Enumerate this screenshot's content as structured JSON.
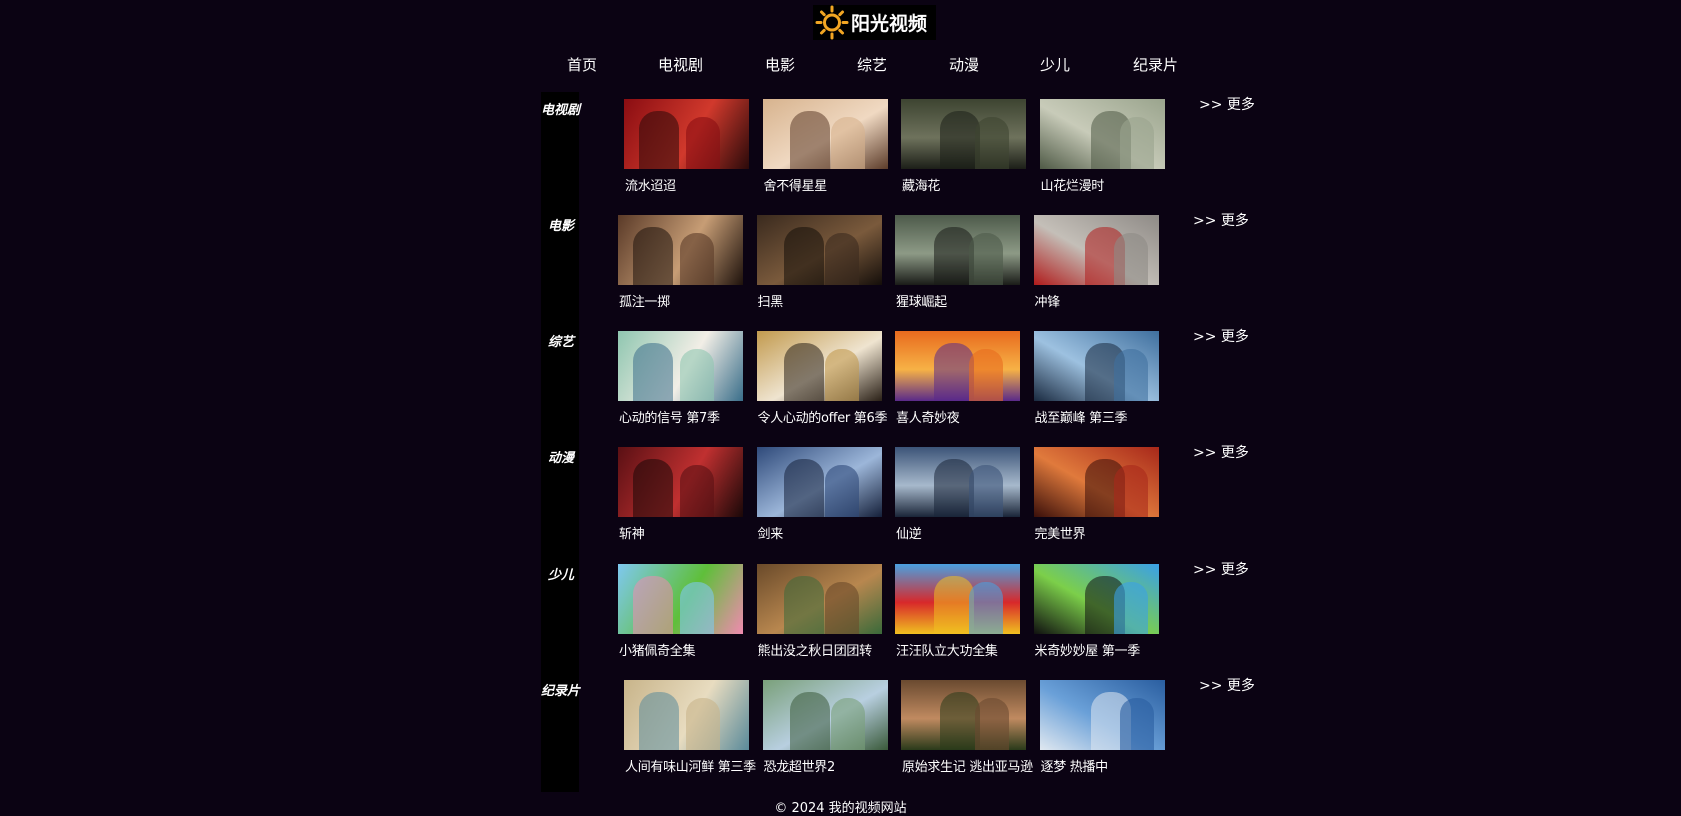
{
  "logo": {
    "text": "阳光视频"
  },
  "nav": [
    "首页",
    "电视剧",
    "电影",
    "综艺",
    "动漫",
    "少儿",
    "纪录片"
  ],
  "more_label": ">> 更多",
  "sections": [
    {
      "title": "电视剧",
      "items": [
        {
          "title": "流水迢迢",
          "palette": [
            "#8a0d12",
            "#d1392c",
            "#2a0a0a"
          ]
        },
        {
          "title": "舍不得星星",
          "palette": [
            "#d7b38e",
            "#f0d9c2",
            "#5c3c2a"
          ]
        },
        {
          "title": "藏海花",
          "palette": [
            "#3d4431",
            "#6e725c",
            "#1c1f18"
          ]
        },
        {
          "title": "山花烂漫时",
          "palette": [
            "#9aa48d",
            "#c8cbb9",
            "#4f5a46"
          ]
        }
      ]
    },
    {
      "title": "电影",
      "items": [
        {
          "title": "孤注一掷",
          "palette": [
            "#5a3a28",
            "#c79d75",
            "#1e120c"
          ]
        },
        {
          "title": "扫黑",
          "palette": [
            "#3a2a1e",
            "#7a5a3c",
            "#140e0a"
          ]
        },
        {
          "title": "猩球崛起",
          "palette": [
            "#4d5a4a",
            "#8d9a86",
            "#1a1c18"
          ]
        },
        {
          "title": "冲锋",
          "palette": [
            "#8e8a86",
            "#c4bfb8",
            "#b01b1b"
          ]
        }
      ]
    },
    {
      "title": "综艺",
      "items": [
        {
          "title": "心动的信号 第7季",
          "palette": [
            "#8fc6b0",
            "#f2eee6",
            "#3a6e8a"
          ]
        },
        {
          "title": "令人心动的offer 第6季",
          "palette": [
            "#c29a4e",
            "#efe4d0",
            "#2a2017"
          ]
        },
        {
          "title": "喜人奇妙夜",
          "palette": [
            "#e86a1e",
            "#f7b246",
            "#5a2a8a"
          ]
        },
        {
          "title": "战至巅峰 第三季",
          "palette": [
            "#3f6f9e",
            "#9dc1e0",
            "#1a2a40"
          ]
        }
      ]
    },
    {
      "title": "动漫",
      "items": [
        {
          "title": "斩神",
          "palette": [
            "#5a1014",
            "#c03030",
            "#1a0808"
          ]
        },
        {
          "title": "剑来",
          "palette": [
            "#2f4a7a",
            "#9cb6d9",
            "#15203a"
          ]
        },
        {
          "title": "仙逆",
          "palette": [
            "#3c5478",
            "#a7b9cc",
            "#1a2538"
          ]
        },
        {
          "title": "完美世界",
          "palette": [
            "#a8281a",
            "#e07a3c",
            "#3a0f0a"
          ]
        }
      ]
    },
    {
      "title": "少儿",
      "items": [
        {
          "title": "小猪佩奇全集",
          "palette": [
            "#7fc8f0",
            "#5fbf3a",
            "#f08ab0"
          ]
        },
        {
          "title": "熊出没之秋日团团转",
          "palette": [
            "#6a4a2a",
            "#b8874f",
            "#3a6a3a"
          ]
        },
        {
          "title": "汪汪队立大功全集",
          "palette": [
            "#4aa0e0",
            "#d8282a",
            "#f0c020"
          ]
        },
        {
          "title": "米奇妙妙屋 第一季",
          "palette": [
            "#3aa0e8",
            "#7ccf4a",
            "#101010"
          ]
        }
      ]
    },
    {
      "title": "纪录片",
      "items": [
        {
          "title": "人间有味山河鲜 第三季",
          "palette": [
            "#c8b48a",
            "#e8dcc0",
            "#5a8a9a"
          ]
        },
        {
          "title": "恐龙超世界2",
          "palette": [
            "#7aa07a",
            "#b8cfe0",
            "#3a5a3a"
          ]
        },
        {
          "title": "原始求生记 逃出亚马逊",
          "palette": [
            "#6a4a30",
            "#c08a60",
            "#2a3a1a"
          ]
        },
        {
          "title": "逐梦 热播中",
          "palette": [
            "#2a5ea0",
            "#6aa0d8",
            "#e0e8f0"
          ]
        }
      ]
    }
  ],
  "footer": "© 2024 我的视频网站"
}
